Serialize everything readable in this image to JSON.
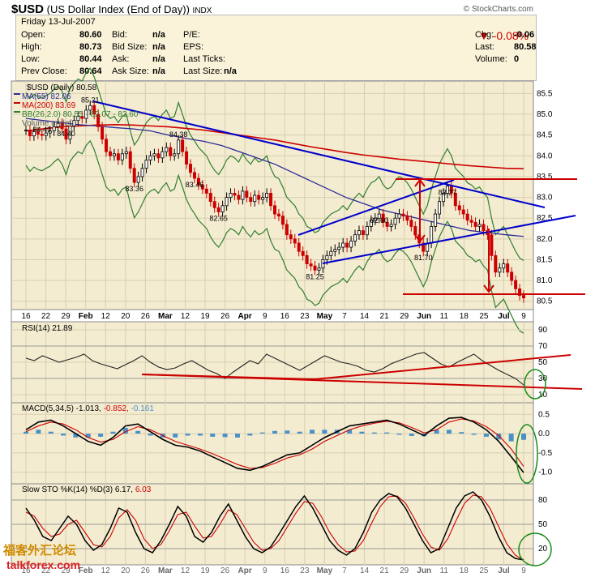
{
  "header": {
    "symbol": "$USD",
    "name": "(US Dollar Index (End of Day))",
    "exchange": "INDX",
    "credit": "© StockCharts.com"
  },
  "quote": {
    "date": "Friday   13-Jul-2007",
    "change_pct": "-0.08%",
    "rows": [
      {
        "l1": "Open:",
        "v1": "80.60",
        "l2": "Bid:",
        "v2": "n/a",
        "l3": "P/E:",
        "v3": "",
        "l4": "Chg:",
        "v4": "-0.06"
      },
      {
        "l1": "High:",
        "v1": "80.73",
        "l2": "Bid Size:",
        "v2": "n/a",
        "l3": "EPS:",
        "v3": "",
        "l4": "Last:",
        "v4": "80.58"
      },
      {
        "l1": "Low:",
        "v1": "80.44",
        "l2": "Ask:",
        "v2": "n/a",
        "l3": "Last Ticks:",
        "v3": "",
        "l4": "Volume:",
        "v4": "0"
      },
      {
        "l1": "Prev Close:",
        "v1": "80.64",
        "l2": "Ask Size:",
        "v2": "n/a",
        "l3": "Last Size:",
        "v3": "n/a",
        "l4": "",
        "v4": ""
      }
    ]
  },
  "legends": {
    "main": "$USD (Daily) 80.58",
    "ma55": "MA(55) 82.06",
    "ma200": "MA(200) 83.69",
    "bb": "BB(26,2.0) 80.55 - 82.07 - 83.60",
    "volume": "Volume undef",
    "rsi": "RSI(14) 21.89",
    "macd_a": "MACD(5,34,5) -1.013,",
    "macd_b": "-0.852,",
    "macd_c": "-0.161",
    "sto_a": "Slow STO %K(14) %D(3) 6.17,",
    "sto_b": "6.03"
  },
  "watermark": {
    "cn": "福客外汇论坛",
    "site": "talkforex.com"
  },
  "colors": {
    "panel_bg": "#f4ecd0",
    "quote_bg": "#fbf3d9",
    "up": "#000000",
    "down": "#cc0000",
    "ma55": "#2b2b9a",
    "ma200": "#cc0000",
    "bb": "#2f7f2f",
    "trend": "#0000cc",
    "annot": "#cc0000",
    "macd_hist": "#4a90c8",
    "ellipse": "#1a8a1a"
  },
  "chart_data": [
    {
      "type": "candlestick",
      "title": "$USD (Daily) 80.58",
      "y_ticks": [
        80.5,
        81.0,
        81.5,
        82.0,
        82.5,
        83.0,
        83.5,
        84.0,
        84.5,
        85.0,
        85.5
      ],
      "ylim": [
        80.3,
        85.8
      ],
      "x_ticks": [
        "16",
        "22",
        "29",
        "Feb",
        "12",
        "20",
        "26",
        "Mar",
        "12",
        "19",
        "26",
        "Apr",
        "9",
        "16",
        "23",
        "May",
        "7",
        "14",
        "21",
        "29",
        "Jun",
        "11",
        "18",
        "25",
        "Jul",
        "9"
      ],
      "close_series": [
        84.62,
        84.48,
        84.58,
        84.52,
        84.49,
        84.55,
        84.6,
        84.7,
        84.78,
        84.65,
        84.4,
        84.72,
        84.85,
        84.95,
        84.9,
        85.1,
        85.21,
        85.0,
        84.7,
        84.4,
        84.1,
        84.0,
        84.05,
        83.9,
        84.05,
        84.1,
        83.7,
        83.36,
        83.5,
        83.7,
        83.9,
        84.0,
        84.05,
        83.95,
        84.1,
        84.2,
        84.0,
        84.05,
        84.38,
        84.1,
        83.8,
        83.6,
        83.46,
        83.3,
        83.2,
        83.1,
        82.9,
        82.75,
        82.65,
        82.8,
        83.0,
        83.1,
        83.05,
        82.95,
        83.15,
        83.0,
        82.9,
        83.05,
        82.95,
        83.0,
        83.1,
        82.8,
        82.6,
        82.55,
        82.35,
        82.1,
        82.0,
        81.9,
        81.7,
        81.6,
        81.4,
        81.35,
        81.25,
        81.3,
        81.5,
        81.6,
        81.7,
        81.75,
        81.8,
        81.9,
        81.8,
        81.95,
        82.1,
        82.2,
        82.1,
        82.3,
        82.45,
        82.5,
        82.6,
        82.4,
        82.3,
        82.35,
        82.5,
        82.6,
        82.55,
        82.45,
        82.3,
        82.1,
        81.9,
        81.7,
        81.9,
        82.3,
        82.6,
        82.9,
        83.1,
        83.27,
        83.1,
        82.8,
        82.7,
        82.6,
        82.45,
        82.4,
        82.3,
        82.35,
        82.2,
        82.1,
        81.6,
        81.2,
        81.3,
        81.4,
        81.2,
        81.0,
        80.8,
        80.64,
        80.58
      ],
      "ma55": [
        84.9,
        84.85,
        84.8,
        84.75,
        84.72,
        84.68,
        84.65,
        84.6,
        84.5,
        84.42,
        84.35,
        84.25,
        84.1,
        83.95,
        83.8,
        83.6,
        83.4,
        83.2,
        83.0,
        82.85,
        82.7,
        82.6,
        82.5,
        82.4,
        82.3,
        82.2,
        82.15,
        82.1,
        82.06
      ],
      "ma200": [
        84.6,
        84.65,
        84.7,
        84.72,
        84.74,
        84.75,
        84.74,
        84.72,
        84.7,
        84.66,
        84.62,
        84.56,
        84.5,
        84.44,
        84.38,
        84.3,
        84.22,
        84.15,
        84.08,
        84.02,
        83.97,
        83.92,
        83.88,
        83.84,
        83.8,
        83.76,
        83.73,
        83.7,
        83.69
      ],
      "annotations": [
        {
          "label": "85.21",
          "x": 16,
          "y": 85.21
        },
        {
          "label": "84.49",
          "x": 4,
          "y": 84.49
        },
        {
          "label": "84.40",
          "x": 10,
          "y": 84.4
        },
        {
          "label": "84.38",
          "x": 38,
          "y": 84.38
        },
        {
          "label": "83.36",
          "x": 27,
          "y": 83.36
        },
        {
          "label": "83.46",
          "x": 42,
          "y": 83.46
        },
        {
          "label": "82.65",
          "x": 48,
          "y": 82.65
        },
        {
          "label": "81.25",
          "x": 72,
          "y": 81.25
        },
        {
          "label": "82.60",
          "x": 88,
          "y": 82.6
        },
        {
          "label": "81.70",
          "x": 99,
          "y": 81.7
        },
        {
          "label": "83.27",
          "x": 105,
          "y": 83.27
        }
      ]
    },
    {
      "type": "line",
      "title": "RSI(14) 21.89",
      "y_ticks": [
        10,
        30,
        50,
        70,
        90
      ],
      "ylim": [
        0,
        100
      ],
      "values": [
        55,
        52,
        58,
        54,
        50,
        53,
        56,
        60,
        52,
        48,
        45,
        42,
        47,
        52,
        58,
        50,
        44,
        41,
        43,
        48,
        52,
        46,
        40,
        36,
        30,
        38,
        45,
        52,
        48,
        60,
        55,
        50,
        45,
        40,
        46,
        52,
        58,
        54,
        50,
        48,
        45,
        40,
        38,
        42,
        48,
        52,
        56,
        60,
        62,
        55,
        48,
        44,
        50,
        55,
        60,
        52,
        46,
        40,
        35,
        30,
        22
      ]
    },
    {
      "type": "bar_line",
      "title": "MACD(5,34,5) -1.013, -0.852, -0.161",
      "y_ticks": [
        0.5,
        0.0,
        -0.5,
        -1.0
      ],
      "ylim": [
        -1.3,
        0.8
      ],
      "macd": [
        0.1,
        0.3,
        0.35,
        0.2,
        0.0,
        -0.2,
        -0.3,
        -0.1,
        0.2,
        0.25,
        0.05,
        -0.15,
        -0.3,
        -0.35,
        -0.45,
        -0.6,
        -0.75,
        -0.9,
        -0.95,
        -0.85,
        -0.7,
        -0.55,
        -0.5,
        -0.3,
        -0.1,
        0.05,
        0.2,
        0.25,
        0.3,
        0.35,
        0.25,
        0.1,
        -0.05,
        0.2,
        0.4,
        0.42,
        0.3,
        0.1,
        -0.2,
        -0.6,
        -1.01
      ],
      "signal": [
        0.05,
        0.2,
        0.3,
        0.25,
        0.1,
        -0.1,
        -0.22,
        -0.15,
        0.05,
        0.18,
        0.1,
        -0.05,
        -0.2,
        -0.3,
        -0.4,
        -0.52,
        -0.66,
        -0.8,
        -0.9,
        -0.88,
        -0.77,
        -0.63,
        -0.55,
        -0.4,
        -0.2,
        -0.05,
        0.1,
        0.2,
        0.27,
        0.32,
        0.28,
        0.16,
        0.02,
        0.1,
        0.3,
        0.38,
        0.33,
        0.18,
        -0.05,
        -0.4,
        -0.85
      ]
    },
    {
      "type": "line",
      "title": "Slow STO %K(14) %D(3) 6.17, 6.03",
      "y_ticks": [
        20,
        50,
        80
      ],
      "ylim": [
        0,
        100
      ],
      "k": [
        70,
        55,
        35,
        30,
        45,
        60,
        50,
        30,
        18,
        25,
        45,
        70,
        65,
        40,
        20,
        15,
        30,
        50,
        72,
        60,
        35,
        28,
        40,
        60,
        75,
        55,
        35,
        20,
        15,
        22,
        38,
        55,
        72,
        85,
        70,
        50,
        30,
        18,
        12,
        20,
        40,
        65,
        80,
        88,
        84,
        70,
        50,
        30,
        15,
        20,
        45,
        70,
        85,
        90,
        80,
        60,
        35,
        15,
        8,
        6
      ],
      "d": [
        65,
        60,
        45,
        35,
        38,
        50,
        55,
        40,
        25,
        22,
        35,
        58,
        68,
        55,
        32,
        20,
        25,
        42,
        62,
        65,
        48,
        33,
        35,
        50,
        68,
        62,
        45,
        28,
        18,
        20,
        30,
        47,
        64,
        78,
        76,
        60,
        40,
        25,
        16,
        17,
        30,
        52,
        72,
        84,
        85,
        76,
        58,
        38,
        22,
        18,
        32,
        55,
        76,
        86,
        84,
        70,
        48,
        26,
        12,
        6
      ]
    }
  ]
}
